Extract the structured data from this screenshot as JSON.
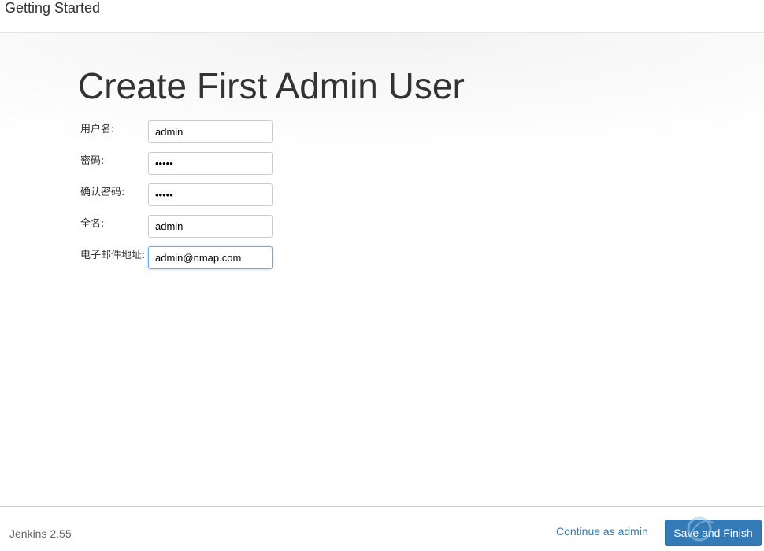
{
  "header": {
    "title": "Getting Started"
  },
  "main": {
    "title": "Create First Admin User",
    "fields": [
      {
        "label": "用户名:",
        "value": "admin",
        "type": "text"
      },
      {
        "label": "密码:",
        "value": "•••••",
        "type": "password"
      },
      {
        "label": "确认密码:",
        "value": "•••••",
        "type": "password"
      },
      {
        "label": "全名:",
        "value": "admin",
        "type": "text"
      },
      {
        "label": "电子邮件地址:",
        "value": "admin@nmap.com",
        "type": "text"
      }
    ]
  },
  "footer": {
    "version": "Jenkins 2.55",
    "continue_label": "Continue as admin",
    "save_label": "Save and Finish"
  },
  "colors": {
    "primary": "#337ab7",
    "link": "#337ab7",
    "focus": "#66afe9"
  }
}
